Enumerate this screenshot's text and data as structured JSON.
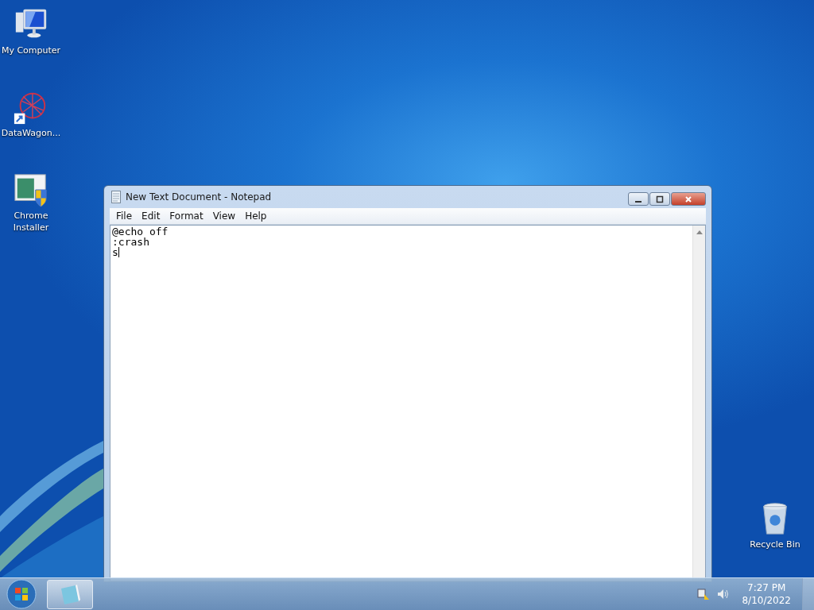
{
  "desktop_icons": [
    {
      "label": "My Computer",
      "kind": "computer"
    },
    {
      "label": "DataWagon...",
      "kind": "shortcut"
    },
    {
      "label": "Chrome Installer",
      "kind": "installer"
    },
    {
      "label": "Recycle Bin",
      "kind": "recycle"
    }
  ],
  "window": {
    "title": "New Text Document - Notepad",
    "menu": [
      "File",
      "Edit",
      "Format",
      "View",
      "Help"
    ],
    "lines": [
      "@echo off",
      ":crash",
      "s"
    ]
  },
  "taskbar": {
    "clock": {
      "time": "7:27 PM",
      "date": "8/10/2022"
    }
  }
}
